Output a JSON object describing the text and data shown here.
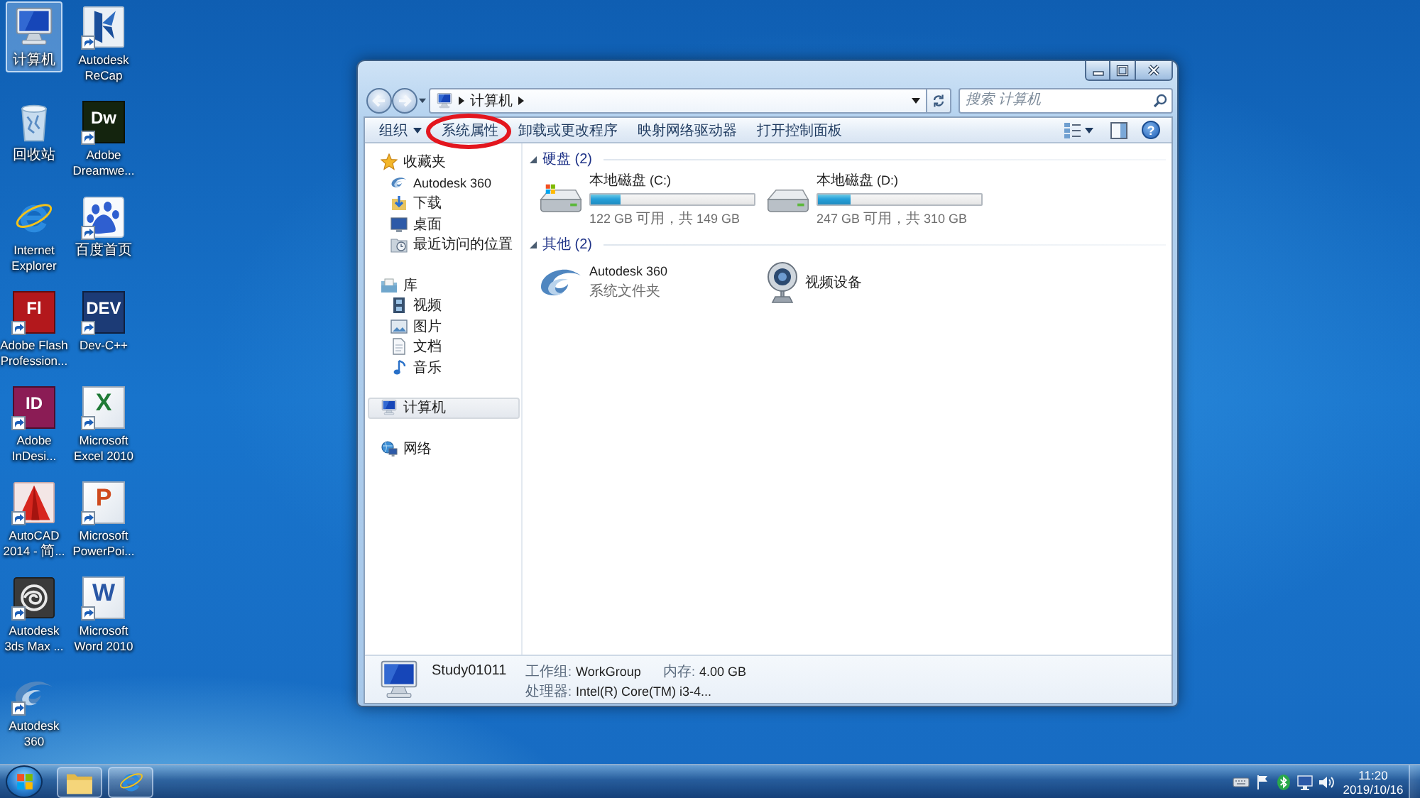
{
  "desktop_icons": [
    {
      "label": "计算机",
      "kind": "computer",
      "selected": true,
      "shortcut": false
    },
    {
      "label": "回收站",
      "kind": "recycle-bin",
      "selected": false,
      "shortcut": false
    },
    {
      "label": "Internet\nExplorer",
      "kind": "browser",
      "selected": false,
      "shortcut": false
    },
    {
      "label": "Adobe Flash\nProfession...",
      "kind": "tile",
      "color": "#b3181c",
      "logo_text": "Fl",
      "selected": false,
      "shortcut": true
    },
    {
      "label": "Adobe\nInDesi...",
      "kind": "tile",
      "color": "#8b1c55",
      "logo_text": "ID",
      "selected": false,
      "shortcut": true
    },
    {
      "label": "AutoCAD\n2014 - 简...",
      "kind": "cad",
      "selected": false,
      "shortcut": true
    },
    {
      "label": "Autodesk\n3ds Max ...",
      "kind": "max",
      "selected": false,
      "shortcut": true
    },
    {
      "label": "Autodesk\n360",
      "kind": "swirl",
      "selected": false,
      "shortcut": true
    },
    {
      "label": "Autodesk\nReCap",
      "kind": "flag",
      "selected": false,
      "shortcut": true
    },
    {
      "label": "Adobe\nDreamwe...",
      "kind": "tile",
      "color": "#14240e",
      "logo_text": "Dw",
      "selected": false,
      "shortcut": true
    },
    {
      "label": "百度首页",
      "kind": "paw",
      "selected": false,
      "shortcut": true
    },
    {
      "label": "Dev-C++",
      "kind": "tile",
      "color": "#1c3b76",
      "logo_text": "DEV",
      "selected": false,
      "shortcut": true
    },
    {
      "label": "Microsoft\nExcel 2010",
      "kind": "document",
      "color": "#1f7a35",
      "logo_text": "X",
      "selected": false,
      "shortcut": true
    },
    {
      "label": "Microsoft\nPowerPoi...",
      "kind": "document",
      "color": "#cf4a1d",
      "logo_text": "P",
      "selected": false,
      "shortcut": true
    },
    {
      "label": "Microsoft\nWord 2010",
      "kind": "document",
      "color": "#2a57a5",
      "logo_text": "W",
      "selected": false,
      "shortcut": true
    }
  ],
  "explorer": {
    "address_path": [
      "计算机"
    ],
    "search": {
      "placeholder": "搜索 计算机"
    },
    "toolbar": [
      {
        "label": "组织",
        "dropdown": true,
        "circled": false
      },
      {
        "label": "系统属性",
        "dropdown": false,
        "circled": true
      },
      {
        "label": "卸载或更改程序",
        "dropdown": false,
        "circled": false
      },
      {
        "label": "映射网络驱动器",
        "dropdown": false,
        "circled": false
      },
      {
        "label": "打开控制面板",
        "dropdown": false,
        "circled": false
      }
    ],
    "help_label": "?",
    "nav_pane": [
      {
        "label": "收藏夹",
        "kind": "star",
        "selected": false,
        "children": [
          {
            "label": "Autodesk 360",
            "kind": "swirl",
            "selected": false
          },
          {
            "label": "下载",
            "kind": "download",
            "selected": false
          },
          {
            "label": "桌面",
            "kind": "desktop",
            "selected": false
          },
          {
            "label": "最近访问的位置",
            "kind": "recent",
            "selected": false
          }
        ]
      },
      {
        "label": "库",
        "kind": "library",
        "selected": false,
        "children": [
          {
            "label": "视频",
            "kind": "video",
            "selected": false
          },
          {
            "label": "图片",
            "kind": "picture",
            "selected": false
          },
          {
            "label": "文档",
            "kind": "document",
            "selected": false
          },
          {
            "label": "音乐",
            "kind": "music",
            "selected": false
          }
        ]
      },
      {
        "label": "计算机",
        "kind": "computer",
        "selected": true
      },
      {
        "label": "网络",
        "kind": "network",
        "selected": false
      }
    ],
    "sections": [
      {
        "title": "硬盘 (2)",
        "expanded": true,
        "items": [
          {
            "kind": "system-drive",
            "name": "本地磁盘 (C:)",
            "level": 0.18,
            "detail": "122 GB 可用，共 149 GB"
          },
          {
            "kind": "drive",
            "name": "本地磁盘 (D:)",
            "level": 0.2,
            "detail": "247 GB 可用，共 310 GB"
          }
        ]
      },
      {
        "title": "其他 (2)",
        "expanded": true,
        "items": [
          {
            "kind": "swirl",
            "name": "Autodesk 360",
            "detail": "系统文件夹"
          },
          {
            "kind": "webcam",
            "name": "视频设备"
          }
        ]
      }
    ],
    "details": {
      "name": "Study01011",
      "fields": [
        {
          "label": "工作组:",
          "value": "WorkGroup"
        },
        {
          "label": "内存:",
          "value": "4.00 GB"
        },
        {
          "label": "处理器:",
          "value": "Intel(R) Core(TM) i3-4..."
        }
      ]
    }
  },
  "taskbar": {
    "pinned": [
      {
        "kind": "folder"
      },
      {
        "kind": "browser"
      }
    ],
    "clock": {
      "time": "11:20",
      "date": "2019/10/16"
    }
  }
}
